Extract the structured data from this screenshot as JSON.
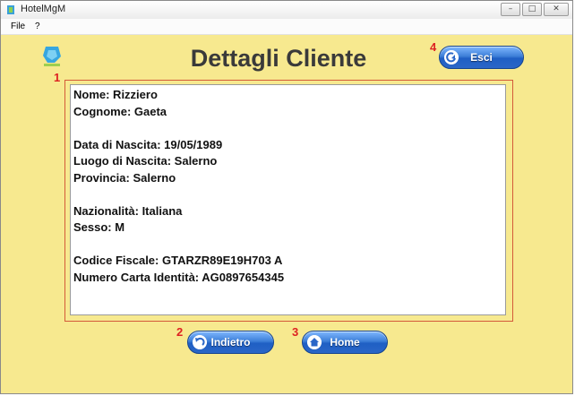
{
  "window": {
    "title": "HotelMgM"
  },
  "menu": [
    "File",
    "?"
  ],
  "page": {
    "title": "Dettagli Cliente"
  },
  "markers": [
    "1",
    "2",
    "3",
    "4"
  ],
  "details": {
    "nome": "Nome: Rizziero",
    "cognome": "Cognome: Gaeta",
    "data_nascita": "Data di Nascita: 19/05/1989",
    "luogo_nascita": "Luogo di Nascita: Salerno",
    "provincia": "Provincia: Salerno",
    "nazionalita": "Nazionalità: Italiana",
    "sesso": "Sesso: M",
    "codice_fiscale": "Codice Fiscale: GTARZR89E19H703 A",
    "carta_identita": "Numero Carta Identità: AG0897654345"
  },
  "buttons": {
    "esci": "Esci",
    "indietro": "Indietro",
    "home": "Home"
  },
  "icons": {
    "app": "hotel-app-icon",
    "logo": "hotel-logo",
    "esci": "logout-arrow-icon",
    "indietro": "back-arrow-icon",
    "home": "home-icon"
  },
  "colors": {
    "background": "#f7e98f",
    "button": "#2a66c7",
    "marker": "#d22222",
    "title": "#3a3a3a"
  }
}
